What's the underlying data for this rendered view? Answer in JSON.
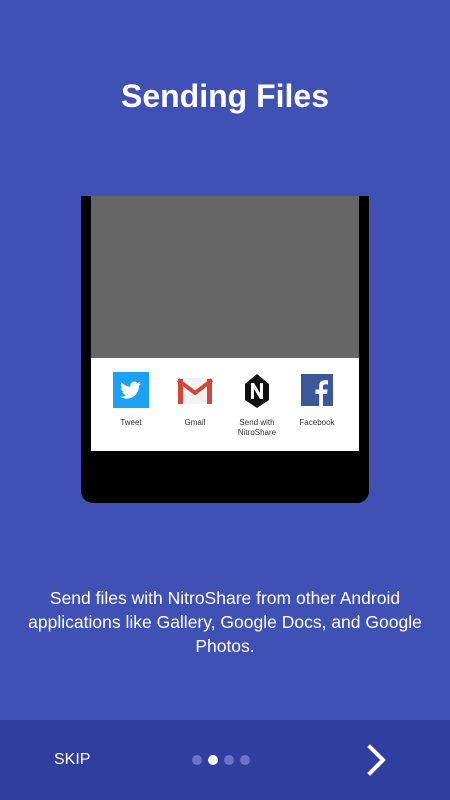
{
  "title": "Sending Files",
  "share_sheet": {
    "items": [
      {
        "label": "Tweet",
        "icon": "twitter-icon"
      },
      {
        "label": "Gmail",
        "icon": "gmail-icon"
      },
      {
        "label": "Send with\nNitroShare",
        "icon": "nitroshare-icon"
      },
      {
        "label": "Facebook",
        "icon": "facebook-icon"
      }
    ]
  },
  "description": "Send files with NitroShare from other Android applications like Gallery, Google Docs, and Google Photos.",
  "bottom_bar": {
    "skip_label": "SKIP",
    "page_count": 4,
    "current_page": 2,
    "next_icon": "chevron-right-icon"
  },
  "colors": {
    "background": "#3f51b5",
    "bottom_bar": "#303f9f",
    "twitter": "#1da1f2",
    "facebook": "#3b5998",
    "gmail": "#d44638"
  }
}
